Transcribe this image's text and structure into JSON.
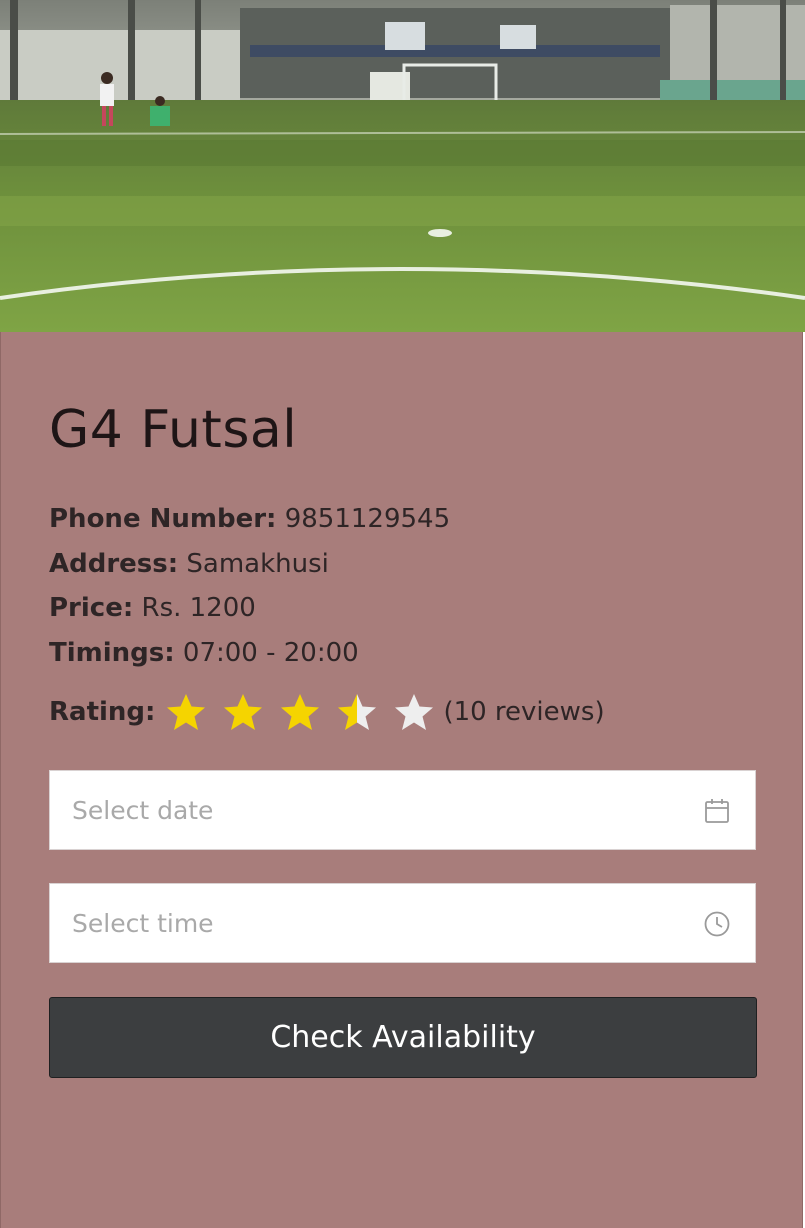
{
  "venue": {
    "name": "G4 Futsal",
    "photo_alt": "futsal-court-photo"
  },
  "details": {
    "phone_label": "Phone Number:",
    "phone_value": "9851129545",
    "address_label": "Address:",
    "address_value": "Samakhusi",
    "price_label": "Price:",
    "price_value": "Rs. 1200",
    "timings_label": "Timings:",
    "timings_value": "07:00 - 20:00",
    "rating_label": "Rating:",
    "rating_value": 3.5,
    "rating_max": 5,
    "reviews_text": "(10 reviews)"
  },
  "form": {
    "date_placeholder": "Select date",
    "date_icon": "calendar-icon",
    "time_placeholder": "Select time",
    "time_icon": "clock-icon",
    "submit_label": "Check Availability"
  },
  "colors": {
    "card_background": "#a87d7b",
    "star_filled": "#f5d400",
    "star_empty": "#eeeeee",
    "button_background": "#3c3e40"
  }
}
